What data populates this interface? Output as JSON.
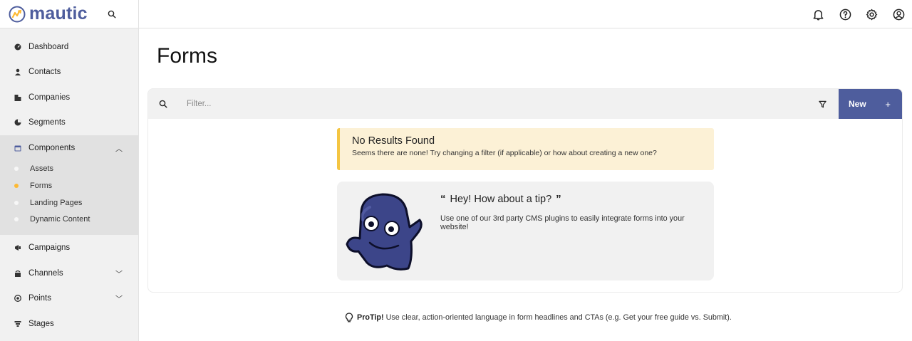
{
  "app": {
    "logo_text": "mautic",
    "brand_color": "#4e5d9d",
    "accent_color": "#fdb933"
  },
  "sidebar": {
    "items": [
      {
        "label": "Dashboard",
        "icon": "dashboard-icon"
      },
      {
        "label": "Contacts",
        "icon": "user-icon"
      },
      {
        "label": "Companies",
        "icon": "building-icon"
      },
      {
        "label": "Segments",
        "icon": "pie-chart-icon"
      },
      {
        "label": "Components",
        "icon": "calendar-icon",
        "expanded": true
      },
      {
        "label": "Campaigns",
        "icon": "megaphone-icon"
      },
      {
        "label": "Channels",
        "icon": "broadcast-icon",
        "expandable": true
      },
      {
        "label": "Points",
        "icon": "target-icon",
        "expandable": true
      },
      {
        "label": "Stages",
        "icon": "stages-icon"
      }
    ],
    "components_sub": [
      {
        "label": "Assets",
        "active": false
      },
      {
        "label": "Forms",
        "active": true
      },
      {
        "label": "Landing Pages",
        "active": false
      },
      {
        "label": "Dynamic Content",
        "active": false
      }
    ]
  },
  "topbar": {
    "icons": [
      "bell-icon",
      "help-icon",
      "gear-icon",
      "user-circle-icon"
    ]
  },
  "main": {
    "title": "Forms",
    "filter_placeholder": "Filter...",
    "new_label": "New",
    "new_plus": "+",
    "alert": {
      "title": "No Results Found",
      "text": "Seems there are none! Try changing a filter (if applicable) or how about creating a new one?"
    },
    "tip": {
      "title": "Hey! How about a tip?",
      "open_quote": "“",
      "close_quote": "”",
      "text": "Use one of our 3rd party CMS plugins to easily integrate forms into your website!"
    },
    "protip": {
      "label": "ProTip!",
      "text": "Use clear, action-oriented language in form headlines and CTAs (e.g. Get your free guide vs. Submit)."
    }
  }
}
